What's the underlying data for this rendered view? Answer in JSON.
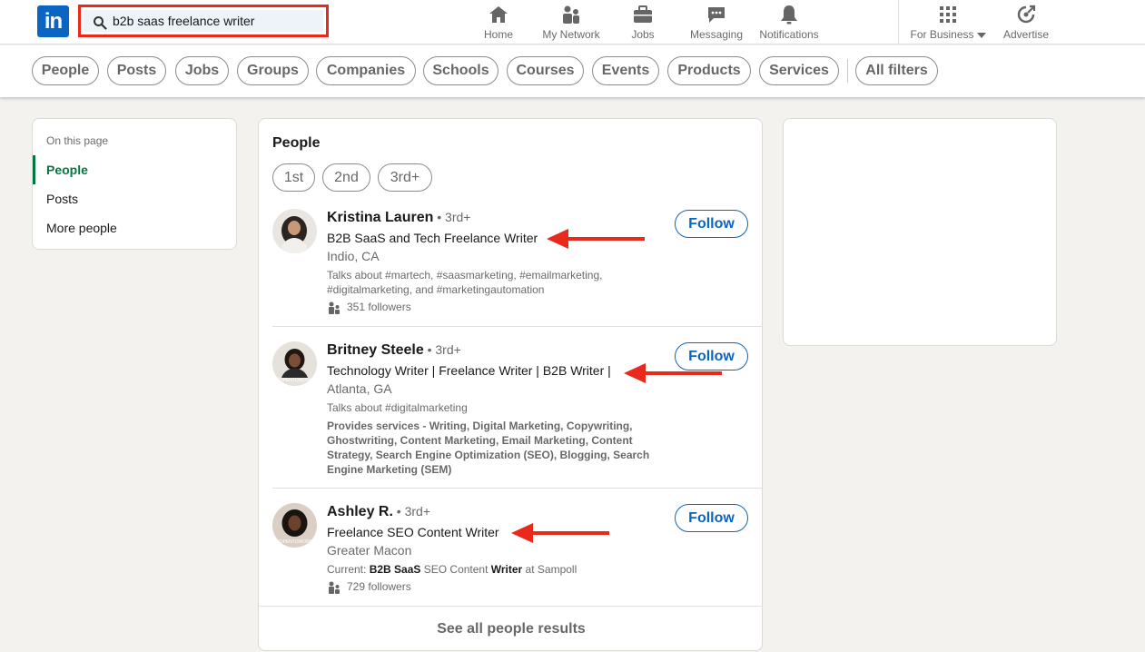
{
  "nav": {
    "logo_text": "in",
    "search_value": "b2b saas freelance writer",
    "items": [
      {
        "label": "Home",
        "icon": "home-icon"
      },
      {
        "label": "My Network",
        "icon": "network-icon"
      },
      {
        "label": "Jobs",
        "icon": "briefcase-icon"
      },
      {
        "label": "Messaging",
        "icon": "messaging-icon"
      },
      {
        "label": "Notifications",
        "icon": "bell-icon"
      },
      {
        "label": "For Business",
        "icon": "grid-icon"
      },
      {
        "label": "Advertise",
        "icon": "advertise-icon"
      }
    ]
  },
  "filters": [
    "People",
    "Posts",
    "Jobs",
    "Groups",
    "Companies",
    "Schools",
    "Courses",
    "Events",
    "Products",
    "Services",
    "All filters"
  ],
  "on_this_page": {
    "title": "On this page",
    "items": [
      "People",
      "Posts",
      "More people"
    ]
  },
  "people": {
    "title": "People",
    "connection_filters": [
      "1st",
      "2nd",
      "3rd+"
    ],
    "results": [
      {
        "name": "Kristina Lauren",
        "degree": " • 3rd+",
        "headline": "B2B SaaS and Tech Freelance Writer",
        "location": "Indio, CA",
        "talks_about": "Talks about #martech, #saasmarketing, #emailmarketing, #digitalmarketing, and #marketingautomation",
        "followers": "351 followers",
        "button": "Follow"
      },
      {
        "name": "Britney Steele",
        "degree": " • 3rd+",
        "headline": "Technology Writer | Freelance Writer | B2B Writer |",
        "location": "Atlanta, GA",
        "talks_about": "Talks about #digitalmarketing",
        "services": "Provides services - Writing, Digital Marketing, Copywriting, Ghostwriting, Content Marketing, Email Marketing, Content Strategy, Search Engine Optimization (SEO), Blogging, Search Engine Marketing (SEM)",
        "button": "Follow"
      },
      {
        "name": "Ashley R.",
        "degree": " • 3rd+",
        "headline": "Freelance SEO Content Writer",
        "location": "Greater Macon",
        "current_prefix": "Current: ",
        "current_bold1": "B2B SaaS",
        "current_mid": " SEO Content ",
        "current_bold2": "Writer",
        "current_suffix": " at Sampoll",
        "followers": "729 followers",
        "button": "Follow"
      }
    ],
    "see_all": "See all people results"
  },
  "colors": {
    "brand": "#0a66c2",
    "active": "#057642",
    "annotation": "#e8291c"
  }
}
